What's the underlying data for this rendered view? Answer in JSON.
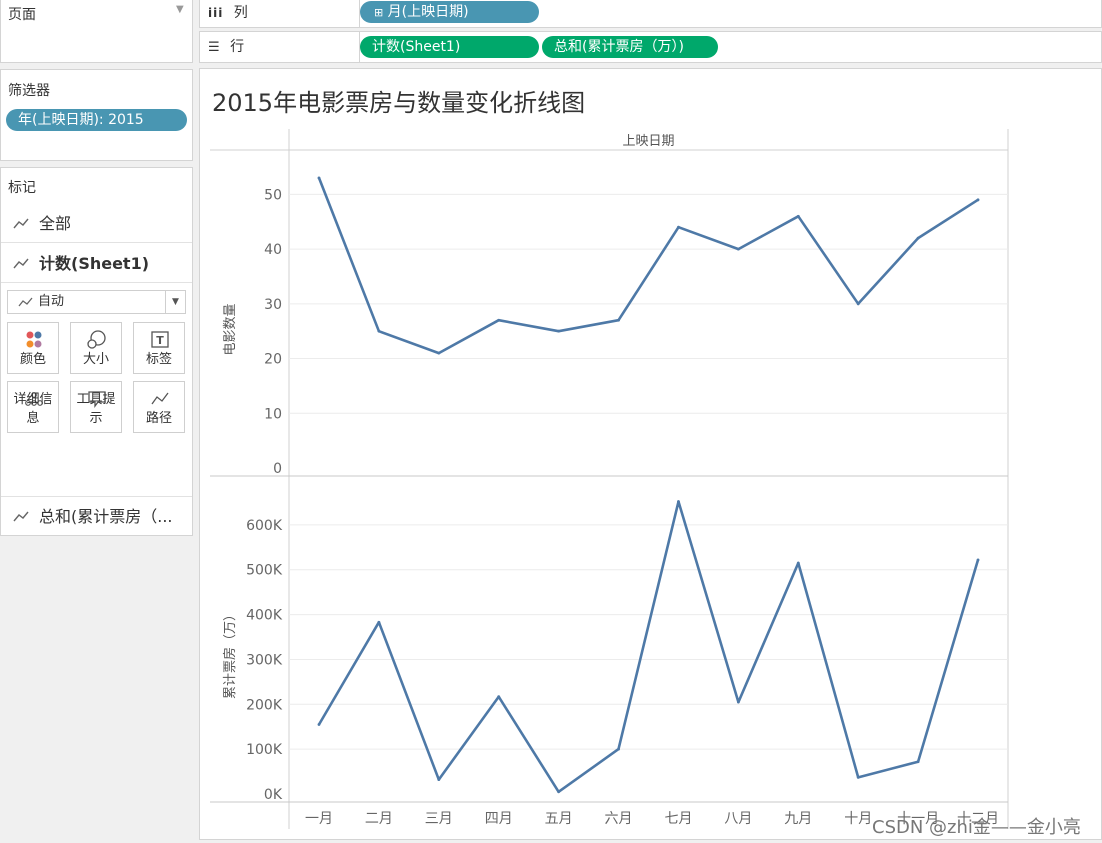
{
  "pages": {
    "title": "页面"
  },
  "filters": {
    "title": "筛选器",
    "pill": "年(上映日期): 2015"
  },
  "marks": {
    "title": "标记",
    "all": "全部",
    "count": "计数(Sheet1)",
    "type": "自动",
    "buttons": [
      "颜色",
      "大小",
      "标签",
      "详细信息",
      "工具提示",
      "路径"
    ],
    "sum": "总和(累计票房（..."
  },
  "shelves": {
    "columns_label": "列",
    "rows_label": "行",
    "columns_pill": "月(上映日期)",
    "rows_pills": [
      "计数(Sheet1)",
      "总和(累计票房（万）)"
    ]
  },
  "colors": {
    "line": "#4e79a7",
    "pill_blue": "#4996b2",
    "pill_green": "#00a86b"
  },
  "watermark": "CSDN @zhi金——金小亮",
  "chart_data": [
    {
      "type": "line",
      "title": "2015年电影票房与数量变化折线图",
      "header": "上映日期",
      "ylabel": "电影数量",
      "categories": [
        "一月",
        "二月",
        "三月",
        "四月",
        "五月",
        "六月",
        "七月",
        "八月",
        "九月",
        "十月",
        "十一月",
        "十二月"
      ],
      "values": [
        53,
        25,
        21,
        27,
        25,
        27,
        44,
        40,
        46,
        30,
        42,
        49
      ],
      "yticks": [
        "0",
        "10",
        "20",
        "30",
        "40",
        "50"
      ],
      "ylim": [
        0,
        55
      ]
    },
    {
      "type": "line",
      "ylabel": "累计票房（万）",
      "categories": [
        "一月",
        "二月",
        "三月",
        "四月",
        "五月",
        "六月",
        "七月",
        "八月",
        "九月",
        "十月",
        "十一月",
        "十二月"
      ],
      "values": [
        155000,
        383000,
        32000,
        217000,
        5000,
        100000,
        652000,
        205000,
        515000,
        37000,
        72000,
        522000
      ],
      "yticks": [
        "0K",
        "100K",
        "200K",
        "300K",
        "400K",
        "500K",
        "600K"
      ],
      "ylim": [
        0,
        680000
      ]
    }
  ]
}
